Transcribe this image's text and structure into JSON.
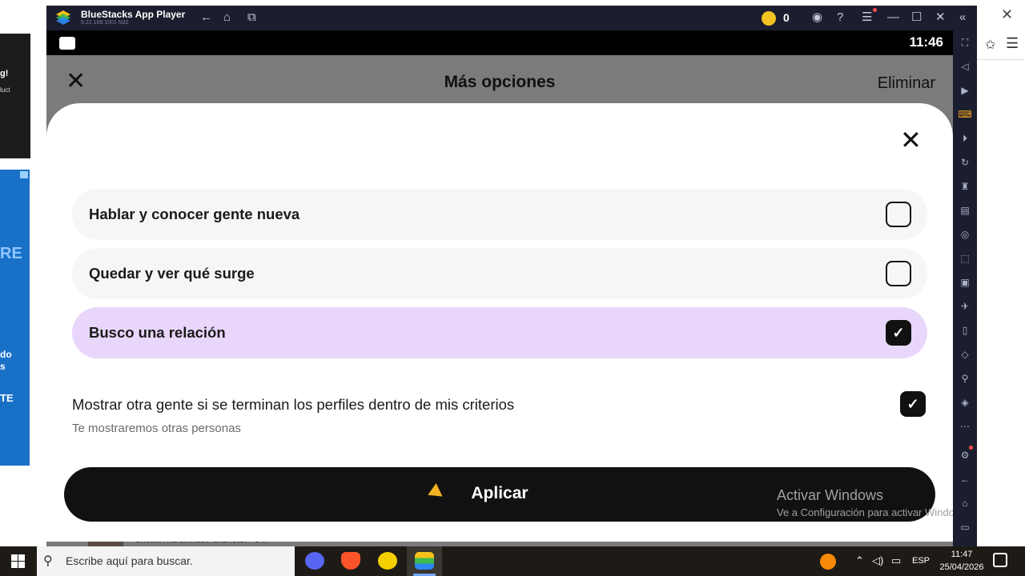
{
  "outside_browser": {
    "left_top_line1": "g!",
    "left_top_line2": "luct",
    "left_ad_big": "RE",
    "left_ad_line1": "do",
    "left_ad_line2": "s",
    "left_ad_cta": "TE"
  },
  "bluestacks": {
    "app_name": "BlueStacks App Player",
    "version": "5.22.168.1001 N32",
    "coins": "0",
    "title_icons": [
      "back-icon",
      "home-icon",
      "multi-instance-icon",
      "account-icon",
      "help-icon",
      "menu-icon",
      "minimize-icon",
      "maximize-icon",
      "close-icon",
      "collapse-icon"
    ],
    "toolbar_icons": [
      "fullscreen-icon",
      "volume-icon",
      "media-icon",
      "keyboard-icon",
      "macro-icon",
      "rotate-icon",
      "gamepad-icon",
      "apk-icon",
      "screenshot-icon",
      "resize-icon",
      "folder-icon",
      "airplane-icon",
      "multi-window-icon",
      "eraser-icon",
      "location-icon",
      "layers-icon",
      "more-icon",
      "settings-icon",
      "back-nav-icon",
      "home-nav-icon",
      "recents-icon"
    ]
  },
  "android": {
    "clock": "11:46",
    "header": {
      "title": "Más opciones",
      "delete_label": "Eliminar",
      "close_glyph": "✕"
    },
    "sheet": {
      "close_glyph": "✕",
      "options": [
        {
          "label": "Hablar y conocer gente nueva",
          "checked": false
        },
        {
          "label": "Quedar y ver qué surge",
          "checked": false
        },
        {
          "label": "Busco una relación",
          "checked": true
        }
      ],
      "extra_toggle": {
        "title": "Mostrar otra gente si se terminan los perfiles dentro de mis criterios",
        "subtitle": "Te mostraremos otras personas",
        "checked": true
      },
      "apply_label": "Aplicar",
      "check_glyph": "✓"
    },
    "background_notification": "Cristian ha enviado una foto. · 3 h"
  },
  "watermark": {
    "line1": "Activar Windows",
    "line2": "Ve a Configuración para activar Windows."
  },
  "taskbar": {
    "search_placeholder": "Escribe aquí para buscar.",
    "apps": [
      "discord-icon",
      "brave-icon",
      "app-icon",
      "bluestacks-icon"
    ],
    "language": "ESP",
    "time": "11:47",
    "date": "25/04/2026"
  },
  "colors": {
    "selected_option": "#e8d7fb",
    "option_bg": "#f6f6f6",
    "apply_button": "#111111",
    "bluestacks_chrome": "#1b1e2e"
  }
}
